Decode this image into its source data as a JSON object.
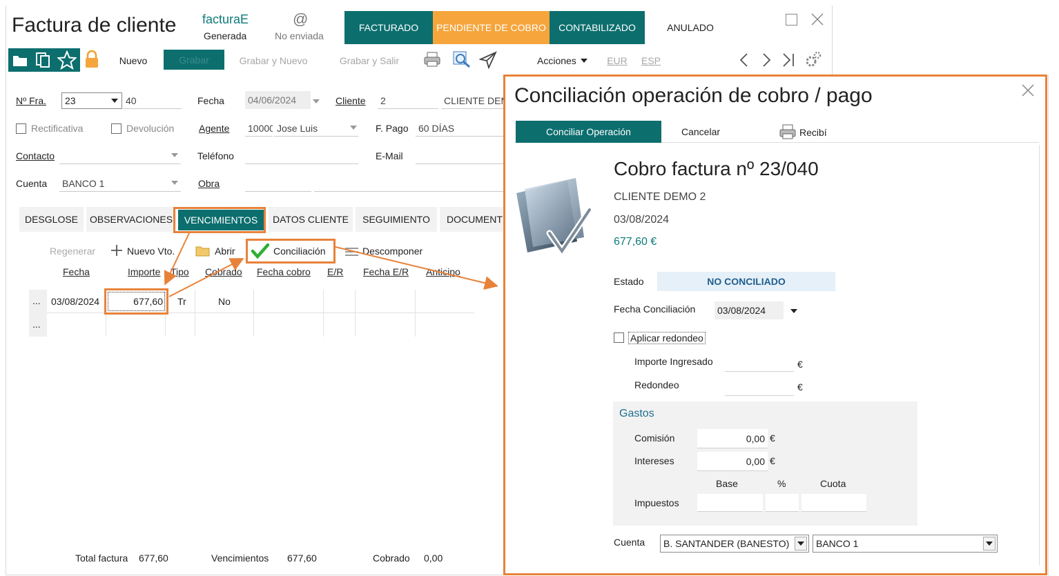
{
  "invoice": {
    "title": "Factura de cliente",
    "facturae": {
      "label": "facturaE",
      "status": "Generada"
    },
    "email": {
      "glyph": "@",
      "status": "No enviada"
    },
    "states": [
      {
        "label": "FACTURADO",
        "color": "#0d6e6e"
      },
      {
        "label": "PENDIENTE DE COBRO",
        "color": "#f5a53c"
      },
      {
        "label": "CONTABILIZADO",
        "color": "#0d6e6e"
      },
      {
        "label": "ANULADO",
        "color": "#ffffff"
      }
    ],
    "toolbar": {
      "nuevo": "Nuevo",
      "grabar": "Grabar",
      "grabar_nuevo": "Grabar y Nuevo",
      "grabar_salir": "Grabar y Salir",
      "acciones": "Acciones",
      "eur": "EUR",
      "esp": "ESP"
    },
    "form": {
      "nfra_label": "Nº Fra.",
      "serie": "23",
      "numero": "40",
      "fecha_label": "Fecha",
      "fecha": "04/06/2024",
      "cliente_label": "Cliente",
      "cliente_code": "2",
      "cliente_name": "CLIENTE DEM",
      "rectificativa": "Rectificativa",
      "devolucion": "Devolución",
      "agente_label": "Agente",
      "agente_code": "10000",
      "agente_name": "Jose Luis",
      "fpago_label": "F. Pago",
      "fpago": "60 DÍAS",
      "contacto_label": "Contacto",
      "telefono_label": "Teléfono",
      "email_label": "E-Mail",
      "cuenta_label": "Cuenta",
      "cuenta": "BANCO 1",
      "obra_label": "Obra"
    },
    "tabs": [
      "DESGLOSE",
      "OBSERVACIONES",
      "VENCIMIENTOS",
      "DATOS CLIENTE",
      "SEGUIMIENTO",
      "DOCUMENT"
    ],
    "grid_toolbar": {
      "regenerar": "Regenerar",
      "nuevo_vto": "Nuevo Vto.",
      "abrir": "Abrir",
      "conciliacion": "Conciliación",
      "descomponer": "Descomponer"
    },
    "grid": {
      "headers": [
        "Fecha",
        "Importe",
        "Tipo",
        "Cobrado",
        "Fecha cobro",
        "E/R",
        "Fecha E/R",
        "Anticipo"
      ],
      "rows": [
        {
          "marker": "...",
          "fecha": "03/08/2024",
          "importe": "677,60",
          "tipo": "Tr",
          "cobrado": "No"
        },
        {
          "marker": "..."
        }
      ]
    },
    "totals": {
      "total_label": "Total factura",
      "total": "677,60",
      "venc_label": "Vencimientos",
      "venc": "677,60",
      "cobrado_label": "Cobrado",
      "cobrado": "0,00"
    }
  },
  "dialog": {
    "title": "Conciliación operación de cobro / pago",
    "buttons": {
      "conciliar": "Conciliar Operación",
      "cancelar": "Cancelar",
      "recibi": "Recibí"
    },
    "heading": "Cobro factura nº 23/040",
    "cliente": "CLIENTE DEMO 2",
    "fecha": "03/08/2024",
    "importe": "677,60 €",
    "estado_label": "Estado",
    "estado": "NO CONCILIADO",
    "fecha_conc_label": "Fecha Conciliación",
    "fecha_conc": "03/08/2024",
    "redondeo_label": "Aplicar redondeo",
    "importe_ingresado_label": "Importe Ingresado",
    "redondeo_field_label": "Redondeo",
    "euro": "€",
    "gastos": {
      "title": "Gastos",
      "comision_label": "Comisión",
      "comision": "0,00",
      "intereses_label": "Intereses",
      "intereses": "0,00",
      "base_label": "Base",
      "pct_label": "%",
      "cuota_label": "Cuota",
      "impuestos_label": "Impuestos"
    },
    "cuenta_label": "Cuenta",
    "cuenta_banco": "B. SANTANDER (BANESTO)",
    "cuenta_sub": "BANCO 1"
  },
  "colors": {
    "teal": "#0d6e6e",
    "orange": "#f5a53c",
    "annotation": "#e8823a",
    "estado_bg": "#e6f0f8"
  }
}
